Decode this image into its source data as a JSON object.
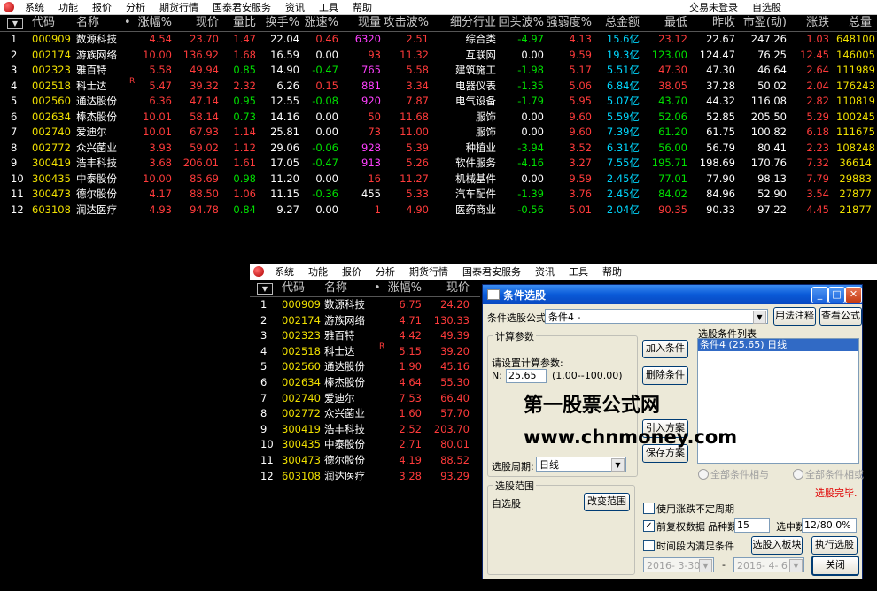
{
  "menu": {
    "items": [
      "系统",
      "功能",
      "报价",
      "分析",
      "期货行情",
      "国泰君安服务",
      "资讯",
      "工具",
      "帮助"
    ],
    "right": [
      "交易未登录",
      "自选股"
    ]
  },
  "columns": [
    "代码",
    "名称",
    "•",
    "涨幅%",
    "现价",
    "量比",
    "换手%",
    "涨速%",
    "现量",
    "攻击波%",
    "细分行业",
    "回头波%",
    "强弱度%",
    "总金额",
    "最低",
    "昨收",
    "市盈(动)",
    "涨跌",
    "总量"
  ],
  "rows": [
    {
      "n": "1",
      "code": "000909",
      "name": "数源科技",
      "mark": "",
      "chg": "4.54",
      "price": "23.70",
      "vr": "1.47",
      "turn": "22.04",
      "spd": "0.46",
      "vol": "6320",
      "atk": "2.51",
      "ind": "综合类",
      "back": "-4.97",
      "str": "4.13",
      "amt": "15.6亿",
      "low": "23.12",
      "prev": "22.67",
      "pe": "247.26",
      "diff": "1.03",
      "total": "648100"
    },
    {
      "n": "2",
      "code": "002174",
      "name": "游族网络",
      "mark": "",
      "chg": "10.00",
      "price": "136.92",
      "vr": "1.68",
      "turn": "16.59",
      "spd": "0.00",
      "vol": "93",
      "atk": "11.32",
      "ind": "互联网",
      "back": "0.00",
      "str": "9.59",
      "amt": "19.3亿",
      "low": "123.00",
      "prev": "124.47",
      "pe": "76.25",
      "diff": "12.45",
      "total": "146005"
    },
    {
      "n": "3",
      "code": "002323",
      "name": "雅百特",
      "mark": "",
      "chg": "5.58",
      "price": "49.94",
      "vr": "0.85",
      "turn": "14.90",
      "spd": "-0.47",
      "vol": "765",
      "atk": "5.58",
      "ind": "建筑施工",
      "back": "-1.98",
      "str": "5.17",
      "amt": "5.51亿",
      "low": "47.30",
      "prev": "47.30",
      "pe": "46.64",
      "diff": "2.64",
      "total": "111989"
    },
    {
      "n": "4",
      "code": "002518",
      "name": "科士达",
      "mark": "R",
      "chg": "5.47",
      "price": "39.32",
      "vr": "2.32",
      "turn": "6.26",
      "spd": "0.15",
      "vol": "881",
      "atk": "3.34",
      "ind": "电器仪表",
      "back": "-1.35",
      "str": "5.06",
      "amt": "6.84亿",
      "low": "38.05",
      "prev": "37.28",
      "pe": "50.02",
      "diff": "2.04",
      "total": "176243"
    },
    {
      "n": "5",
      "code": "002560",
      "name": "通达股份",
      "mark": "",
      "chg": "6.36",
      "price": "47.14",
      "vr": "0.95",
      "turn": "12.55",
      "spd": "-0.08",
      "vol": "920",
      "atk": "7.87",
      "ind": "电气设备",
      "back": "-1.79",
      "str": "5.95",
      "amt": "5.07亿",
      "low": "43.70",
      "prev": "44.32",
      "pe": "116.08",
      "diff": "2.82",
      "total": "110819"
    },
    {
      "n": "6",
      "code": "002634",
      "name": "棒杰股份",
      "mark": "",
      "chg": "10.01",
      "price": "58.14",
      "vr": "0.73",
      "turn": "14.16",
      "spd": "0.00",
      "vol": "50",
      "atk": "11.68",
      "ind": "服饰",
      "back": "0.00",
      "str": "9.60",
      "amt": "5.59亿",
      "low": "52.06",
      "prev": "52.85",
      "pe": "205.50",
      "diff": "5.29",
      "total": "100245"
    },
    {
      "n": "7",
      "code": "002740",
      "name": "爱迪尔",
      "mark": "",
      "chg": "10.01",
      "price": "67.93",
      "vr": "1.14",
      "turn": "25.81",
      "spd": "0.00",
      "vol": "73",
      "atk": "11.00",
      "ind": "服饰",
      "back": "0.00",
      "str": "9.60",
      "amt": "7.39亿",
      "low": "61.20",
      "prev": "61.75",
      "pe": "100.82",
      "diff": "6.18",
      "total": "111675"
    },
    {
      "n": "8",
      "code": "002772",
      "name": "众兴菌业",
      "mark": "",
      "chg": "3.93",
      "price": "59.02",
      "vr": "1.12",
      "turn": "29.06",
      "spd": "-0.06",
      "vol": "928",
      "atk": "5.39",
      "ind": "种植业",
      "back": "-3.94",
      "str": "3.52",
      "amt": "6.31亿",
      "low": "56.00",
      "prev": "56.79",
      "pe": "80.41",
      "diff": "2.23",
      "total": "108248"
    },
    {
      "n": "9",
      "code": "300419",
      "name": "浩丰科技",
      "mark": "",
      "chg": "3.68",
      "price": "206.01",
      "vr": "1.61",
      "turn": "17.05",
      "spd": "-0.47",
      "vol": "913",
      "atk": "5.26",
      "ind": "软件服务",
      "back": "-4.16",
      "str": "3.27",
      "amt": "7.55亿",
      "low": "195.71",
      "prev": "198.69",
      "pe": "170.76",
      "diff": "7.32",
      "total": "36614"
    },
    {
      "n": "10",
      "code": "300435",
      "name": "中泰股份",
      "mark": "",
      "chg": "10.00",
      "price": "85.69",
      "vr": "0.98",
      "turn": "11.20",
      "spd": "0.00",
      "vol": "16",
      "atk": "11.27",
      "ind": "机械基件",
      "back": "0.00",
      "str": "9.59",
      "amt": "2.45亿",
      "low": "77.01",
      "prev": "77.90",
      "pe": "98.13",
      "diff": "7.79",
      "total": "29883"
    },
    {
      "n": "11",
      "code": "300473",
      "name": "德尔股份",
      "mark": "",
      "chg": "4.17",
      "price": "88.50",
      "vr": "1.06",
      "turn": "11.15",
      "spd": "-0.36",
      "vol": "455",
      "atk": "5.33",
      "ind": "汽车配件",
      "back": "-1.39",
      "str": "3.76",
      "amt": "2.45亿",
      "low": "84.02",
      "prev": "84.96",
      "pe": "52.90",
      "diff": "3.54",
      "total": "27877"
    },
    {
      "n": "12",
      "code": "603108",
      "name": "润达医疗",
      "mark": "",
      "chg": "4.93",
      "price": "94.78",
      "vr": "0.84",
      "turn": "9.27",
      "spd": "0.00",
      "vol": "1",
      "atk": "4.90",
      "ind": "医药商业",
      "back": "-0.56",
      "str": "5.01",
      "amt": "2.04亿",
      "low": "90.35",
      "prev": "90.33",
      "pe": "97.22",
      "diff": "4.45",
      "total": "21877"
    }
  ],
  "win2": {
    "menu": [
      "系统",
      "功能",
      "报价",
      "分析",
      "期货行情",
      "国泰君安服务",
      "资讯",
      "工具",
      "帮助"
    ],
    "columns": [
      "代码",
      "名称",
      "•",
      "涨幅%",
      "现价"
    ],
    "rows": [
      {
        "n": "1",
        "code": "000909",
        "name": "数源科技",
        "mark": "",
        "chg": "6.75",
        "price": "24.20"
      },
      {
        "n": "2",
        "code": "002174",
        "name": "游族网络",
        "mark": "",
        "chg": "4.71",
        "price": "130.33"
      },
      {
        "n": "3",
        "code": "002323",
        "name": "雅百特",
        "mark": "",
        "chg": "4.42",
        "price": "49.39"
      },
      {
        "n": "4",
        "code": "002518",
        "name": "科士达",
        "mark": "R",
        "chg": "5.15",
        "price": "39.20"
      },
      {
        "n": "5",
        "code": "002560",
        "name": "通达股份",
        "mark": "",
        "chg": "1.90",
        "price": "45.16"
      },
      {
        "n": "6",
        "code": "002634",
        "name": "棒杰股份",
        "mark": "",
        "chg": "4.64",
        "price": "55.30"
      },
      {
        "n": "7",
        "code": "002740",
        "name": "爱迪尔",
        "mark": "",
        "chg": "7.53",
        "price": "66.40"
      },
      {
        "n": "8",
        "code": "002772",
        "name": "众兴菌业",
        "mark": "",
        "chg": "1.60",
        "price": "57.70"
      },
      {
        "n": "9",
        "code": "300419",
        "name": "浩丰科技",
        "mark": "",
        "chg": "2.52",
        "price": "203.70"
      },
      {
        "n": "10",
        "code": "300435",
        "name": "中泰股份",
        "mark": "",
        "chg": "2.71",
        "price": "80.01"
      },
      {
        "n": "11",
        "code": "300473",
        "name": "德尔股份",
        "mark": "",
        "chg": "4.19",
        "price": "88.52"
      },
      {
        "n": "12",
        "code": "603108",
        "name": "润达医疗",
        "mark": "",
        "chg": "3.28",
        "price": "93.29"
      }
    ]
  },
  "dialog": {
    "title": "条件选股",
    "formula_label": "条件选股公式",
    "formula_value": "条件4         -",
    "btn_usage": "用法注释",
    "btn_view": "查看公式",
    "calc_group": "计算参数",
    "set_param_label": "请设置计算参数:",
    "param_n_label": "N:",
    "param_n_value": "25.65",
    "param_range": "(1.00--100.00)",
    "btn_add": "加入条件",
    "btn_delete": "删除条件",
    "btn_import": "引入方案",
    "btn_save": "保存方案",
    "list_label": "选股条件列表",
    "list_items": [
      "条件4 (25.65) 日线"
    ],
    "period_label": "选股周期:",
    "period_value": "日线",
    "radio_and": "全部条件相与",
    "radio_or": "全部条件相或",
    "status": "选股完毕.",
    "range_group": "选股范围",
    "range_value": "自选股",
    "btn_change_range": "改变范围",
    "chk_irregular": "使用涨跌不定周期",
    "chk_prerights": "前复权数据",
    "count_label": "品种数",
    "count_value": "15",
    "hit_label": "选中数",
    "hit_value": "12/80.0%",
    "chk_timerange": "时间段内满足条件",
    "btn_to_block": "选股入板块",
    "btn_run": "执行选股",
    "date_from": "2016- 3-30",
    "date_to": "2016- 4- 6",
    "dash": "-",
    "btn_close": "关闭",
    "watermark_cn": "第一股票公式网",
    "watermark_url": "www.chnmoney.com"
  },
  "colors": {
    "up": "#ff3b3b",
    "down": "#00e000",
    "code": "#f0e000",
    "amount": "#00d8ff",
    "volume": "#ff40ff"
  }
}
